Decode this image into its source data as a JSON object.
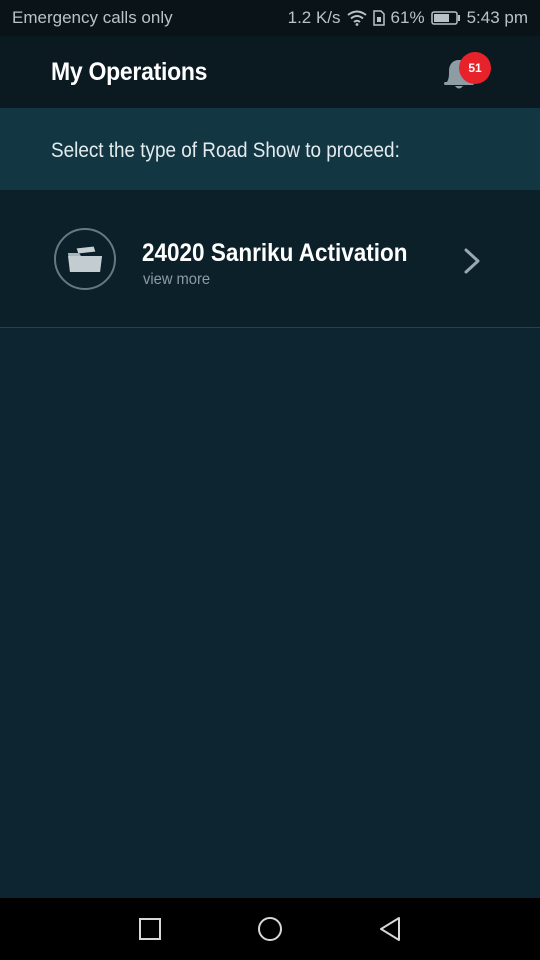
{
  "status_bar": {
    "carrier": "Emergency calls only",
    "network_speed": "1.2 K/s",
    "battery_percent": "61%",
    "time": "5:43 pm"
  },
  "header": {
    "title": "My Operations",
    "notification_count": "51"
  },
  "subtitle": "Select the type of Road Show to proceed:",
  "operations": [
    {
      "title": "24020 Sanriku Activation",
      "subtitle": "view more"
    }
  ],
  "colors": {
    "background": "#0c2530",
    "header": "#0b1a21",
    "subtitle_band": "#123642",
    "badge": "#e8222a"
  }
}
